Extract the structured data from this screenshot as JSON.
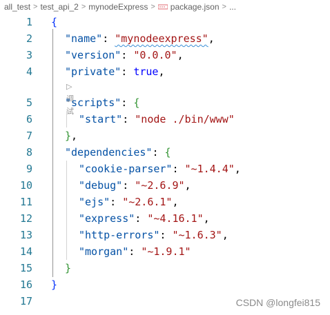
{
  "breadcrumb": {
    "items": [
      "all_test",
      "test_api_2",
      "mynodeExpress",
      "package.json",
      "..."
    ],
    "separator": ">",
    "file_icon": "json-file-icon"
  },
  "editor": {
    "line_numbers": [
      "1",
      "2",
      "3",
      "4",
      "5",
      "6",
      "7",
      "8",
      "9",
      "10",
      "11",
      "12",
      "13",
      "14",
      "15",
      "16",
      "17"
    ],
    "codelens_label": "▷ 调试",
    "lines": {
      "l1": {
        "open": "{"
      },
      "l2": {
        "key": "\"name\"",
        "colon": ": ",
        "value": "\"mynodeexpress\"",
        "comma": ","
      },
      "l3": {
        "key": "\"version\"",
        "colon": ": ",
        "value": "\"0.0.0\"",
        "comma": ","
      },
      "l4": {
        "key": "\"private\"",
        "colon": ": ",
        "value": "true",
        "comma": ","
      },
      "l5": {
        "key": "\"scripts\"",
        "colon": ": ",
        "open": "{"
      },
      "l6": {
        "key": "\"start\"",
        "colon": ": ",
        "value": "\"node ./bin/www\""
      },
      "l7": {
        "close": "}",
        "comma": ","
      },
      "l8": {
        "key": "\"dependencies\"",
        "colon": ": ",
        "open": "{"
      },
      "l9": {
        "key": "\"cookie-parser\"",
        "colon": ": ",
        "value": "\"~1.4.4\"",
        "comma": ","
      },
      "l10": {
        "key": "\"debug\"",
        "colon": ": ",
        "value": "\"~2.6.9\"",
        "comma": ","
      },
      "l11": {
        "key": "\"ejs\"",
        "colon": ": ",
        "value": "\"~2.6.1\"",
        "comma": ","
      },
      "l12": {
        "key": "\"express\"",
        "colon": ": ",
        "value": "\"~4.16.1\"",
        "comma": ","
      },
      "l13": {
        "key": "\"http-errors\"",
        "colon": ": ",
        "value": "\"~1.6.3\"",
        "comma": ","
      },
      "l14": {
        "key": "\"morgan\"",
        "colon": ": ",
        "value": "\"~1.9.1\""
      },
      "l15": {
        "close": "}"
      },
      "l16": {
        "close": "}"
      }
    }
  },
  "watermark": "CSDN @longfei815",
  "colors": {
    "key": "#0451a5",
    "string": "#a31515",
    "boolean": "#0000ff",
    "bracket_level1": "#0431fa",
    "bracket_level2": "#319331",
    "bracket_level3": "#7b3814",
    "line_number": "#237893"
  }
}
